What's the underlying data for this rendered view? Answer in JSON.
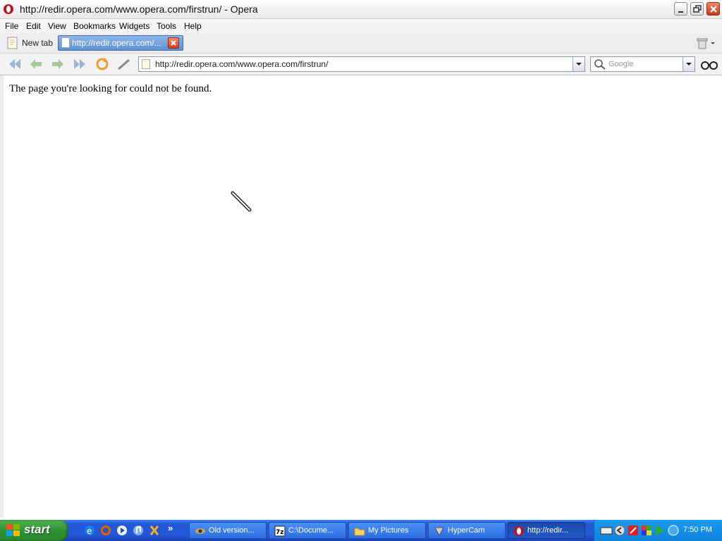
{
  "window": {
    "title": "http://redir.opera.com/www.opera.com/firstrun/ - Opera"
  },
  "menu": {
    "items": [
      "File",
      "Edit",
      "View",
      "Bookmarks",
      "Widgets",
      "Tools",
      "Help"
    ]
  },
  "tabs": {
    "items": [
      {
        "label": "New tab",
        "active": false
      },
      {
        "label": "http://redir.opera.com/...",
        "active": true
      }
    ]
  },
  "address": {
    "url": "http://redir.opera.com/www.opera.com/firstrun/"
  },
  "search": {
    "placeholder": "Google"
  },
  "page": {
    "message": "The page you're looking for could not be found."
  },
  "taskbar": {
    "start_label": "start",
    "buttons": [
      {
        "label": "Old version...",
        "icon": "eye-icon"
      },
      {
        "label": "C:\\Docume...",
        "icon": "7zip-icon"
      },
      {
        "label": "My Pictures",
        "icon": "folder-icon"
      },
      {
        "label": "HyperCam",
        "icon": "hypercam-icon"
      },
      {
        "label": "http://redir...",
        "icon": "opera-icon",
        "active": true
      }
    ],
    "clock": "7:50 PM"
  },
  "colors": {
    "accent_tab": "#5f92d2",
    "taskbar": "#2458d8",
    "start": "#2f8e31",
    "tray": "#0f82dc"
  }
}
